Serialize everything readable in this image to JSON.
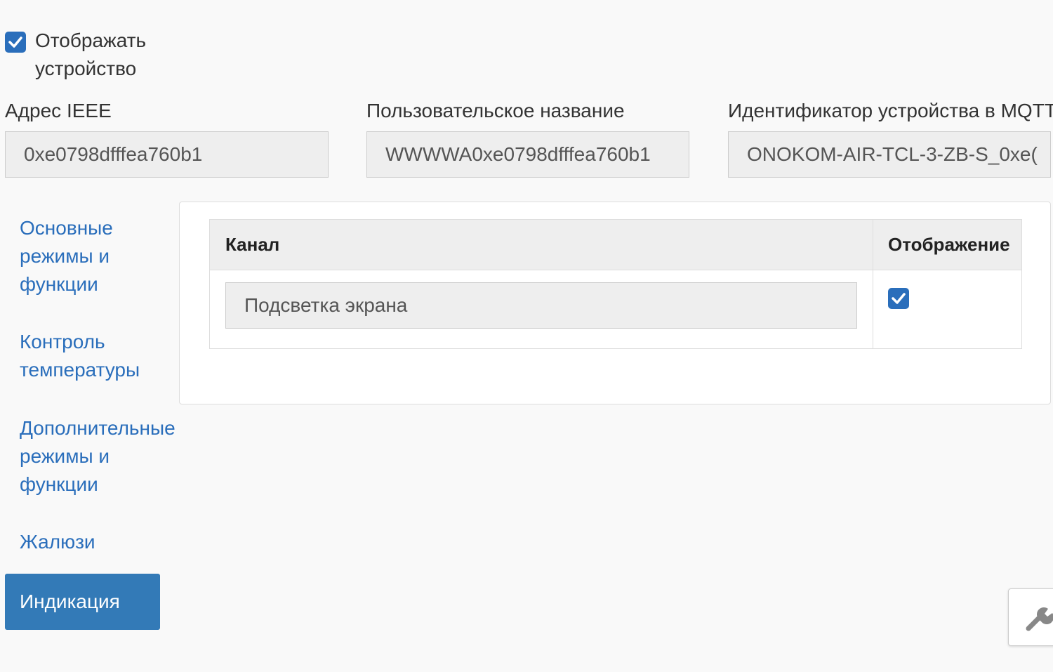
{
  "display_device": {
    "label": "Отображать устройство",
    "checked": true
  },
  "fields": {
    "ieee_label": "Адрес IEEE",
    "ieee_value": "0xe0798dfffea760b1",
    "custom_name_label": "Пользовательское название",
    "custom_name_value": "WWWWA0xe0798dfffea760b1",
    "mqtt_id_label": "Идентификатор устройства в MQTT",
    "mqtt_id_value": "ONOKOM-AIR-TCL-3-ZB-S_0xe("
  },
  "nav": {
    "items": [
      {
        "label": "Основные режимы и функции"
      },
      {
        "label": "Контроль температуры"
      },
      {
        "label": "Дополнительные режимы и функции"
      },
      {
        "label": "Жалюзи"
      }
    ],
    "active": "Индикация"
  },
  "table": {
    "columns": [
      "Канал",
      "Отображение"
    ],
    "rows": [
      {
        "channel": "Подсветка экрана",
        "display": true
      }
    ]
  },
  "colors": {
    "accent": "#337ab7",
    "link": "#2a6ebb",
    "checkbox": "#2a6ebb"
  },
  "icons": {
    "tool_button": "wrench-icon",
    "checkbox": "checkmark-icon"
  }
}
